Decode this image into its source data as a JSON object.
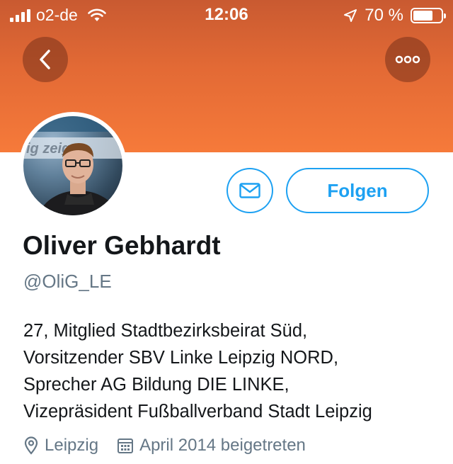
{
  "status_bar": {
    "carrier": "o2-de",
    "time": "12:06",
    "battery": "70 %",
    "battery_level": 0.7
  },
  "header": {
    "background_color": "#f67a3a",
    "back_icon": "chevron-left-icon",
    "more_icon": "ellipsis-icon"
  },
  "profile": {
    "name": "Oliver Gebhardt",
    "handle": "@OliG_LE",
    "follow_label": "Folgen",
    "message_icon": "envelope-icon",
    "avatar_text": "ig zeig",
    "bio_lines": [
      "27, Mitglied Stadtbezirksbeirat Süd,",
      "Vorsitzender SBV Linke Leipzig NORD,",
      "Sprecher AG Bildung DIE LINKE,",
      "Vizepräsident Fußballverband Stadt Leipzig"
    ],
    "location": "Leipzig",
    "joined": "April 2014 beigetreten"
  },
  "colors": {
    "accent": "#1da1f2",
    "secondary_text": "#657786",
    "primary_text": "#14171a"
  }
}
